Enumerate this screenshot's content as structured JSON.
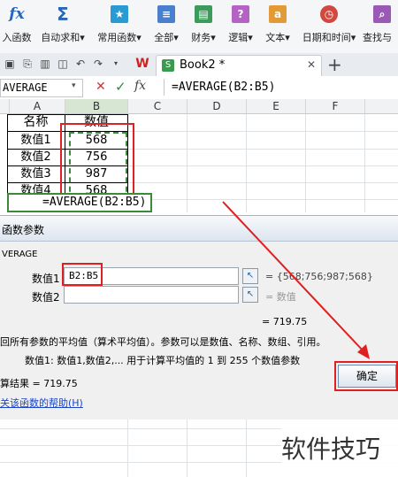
{
  "ribbon": {
    "insert_function": "入函数",
    "insert_function_icon": "fx",
    "autosum": "自动求和",
    "common_functions": "常用函数",
    "all": "全部",
    "finance": "财务",
    "logic": "逻辑",
    "text": "文本",
    "datetime": "日期和时间",
    "lookup": "查找与",
    "dropdown_mark": "▾"
  },
  "tabbar": {
    "doc_name": "Book2 *"
  },
  "formula_bar": {
    "name_box": "AVERAGE",
    "formula": "=AVERAGE(B2:B5)",
    "fx_label": "fx"
  },
  "sheet": {
    "columns": [
      "A",
      "B",
      "C",
      "D",
      "E",
      "F"
    ],
    "rows": [
      {
        "a": "名称",
        "b": "数值"
      },
      {
        "a": "数值1",
        "b": "568"
      },
      {
        "a": "数值2",
        "b": "756"
      },
      {
        "a": "数值3",
        "b": "987"
      },
      {
        "a": "数值4",
        "b": "568"
      }
    ],
    "formula_cell": "=AVERAGE(B2:B5)"
  },
  "dialog": {
    "title": "函数参数",
    "function_name": "VERAGE",
    "arg1_label": "数值1",
    "arg1_value": "B2:B5",
    "arg1_result": "= {568;756;987;568}",
    "arg2_label": "数值2",
    "arg2_result": "= 数值",
    "computed": "= 719.75",
    "description": "回所有参数的平均值（算术平均值）。参数可以是数值、名称、数组、引用。",
    "param_help": "数值1:  数值1,数值2,... 用于计算平均值的 1 到 255 个数值参数",
    "result_label": "算结果 =",
    "result_value": "719.75",
    "help_link": "关该函数的帮助(H)",
    "ok_button": "确定"
  },
  "watermark": "软件技巧",
  "colors": {
    "annotation_red": "#e02020",
    "selection_green": "#3a8a3a"
  }
}
